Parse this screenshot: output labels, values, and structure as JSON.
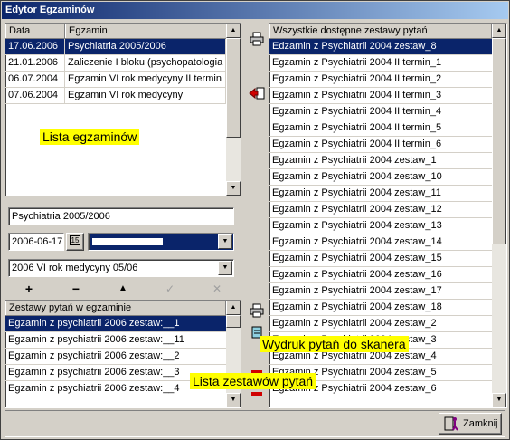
{
  "window": {
    "title": "Edytor Egzaminów"
  },
  "exams": {
    "columns": [
      "Data",
      "Egzamin"
    ],
    "rows": [
      {
        "date": "17.06.2006",
        "name": "Psychiatria 2005/2006",
        "selected": true
      },
      {
        "date": "21.01.2006",
        "name": "Zaliczenie I bloku (psychopatologia o",
        "selected": false
      },
      {
        "date": "06.07.2004",
        "name": "Egzamin VI rok medycyny II termin",
        "selected": false
      },
      {
        "date": "07.06.2004",
        "name": "Egzamin VI rok medycyny",
        "selected": false
      }
    ],
    "annotation": "Lista egzaminów"
  },
  "form": {
    "exam_name": "Psychiatria 2005/2006",
    "date": "2006-06-17",
    "date_button": "15",
    "group": "2006 VI rok medycyny 05/06"
  },
  "toolbar": {
    "add": "+",
    "remove": "−",
    "up": "▲",
    "confirm": "✓",
    "cancel": "✕"
  },
  "exam_sets": {
    "header": "Zestawy pytań w egzaminie",
    "rows": [
      {
        "label": "Egzamin z psychiatrii 2006 zestaw:__1",
        "selected": true
      },
      {
        "label": "Egzamin z psychiatrii 2006 zestaw:__11",
        "selected": false
      },
      {
        "label": "Egzamin z psychiatrii 2006 zestaw:__2",
        "selected": false
      },
      {
        "label": "Egzamin z psychiatrii 2006 zestaw:__3",
        "selected": false
      },
      {
        "label": "Egzamin z psychiatrii 2006 zestaw:__4",
        "selected": false
      }
    ]
  },
  "all_sets": {
    "header": "Wszystkie dostępne zestawy pytań",
    "rows": [
      {
        "label": "Edzamin z Psychiatrii 2004 zestaw_8",
        "selected": true
      },
      {
        "label": "Egzamin z Psychiatrii 2004 II termin_1",
        "selected": false
      },
      {
        "label": "Egzamin z Psychiatrii 2004 II termin_2",
        "selected": false
      },
      {
        "label": "Egzamin z Psychiatrii 2004 II termin_3",
        "selected": false
      },
      {
        "label": "Egzamin z Psychiatrii 2004 II termin_4",
        "selected": false
      },
      {
        "label": "Egzamin z Psychiatrii 2004 II termin_5",
        "selected": false
      },
      {
        "label": "Egzamin z Psychiatrii 2004 II termin_6",
        "selected": false
      },
      {
        "label": "Egzamin z Psychiatrii 2004 zestaw_1",
        "selected": false
      },
      {
        "label": "Egzamin z Psychiatrii 2004 zestaw_10",
        "selected": false
      },
      {
        "label": "Egzamin z Psychiatrii 2004 zestaw_11",
        "selected": false
      },
      {
        "label": "Egzamin z Psychiatrii 2004 zestaw_12",
        "selected": false
      },
      {
        "label": "Egzamin z Psychiatrii 2004 zestaw_13",
        "selected": false
      },
      {
        "label": "Egzamin z Psychiatrii 2004 zestaw_14",
        "selected": false
      },
      {
        "label": "Egzamin z Psychiatrii 2004 zestaw_15",
        "selected": false
      },
      {
        "label": "Egzamin z Psychiatrii 2004 zestaw_16",
        "selected": false
      },
      {
        "label": "Egzamin z Psychiatrii 2004 zestaw_17",
        "selected": false
      },
      {
        "label": "Egzamin z Psychiatrii 2004 zestaw_18",
        "selected": false
      },
      {
        "label": "Egzamin z Psychiatrii 2004 zestaw_2",
        "selected": false
      },
      {
        "label": "Egzamin z Psychiatrii 2004 zestaw_3",
        "selected": false
      },
      {
        "label": "Egzamin z Psychiatrii 2004 zestaw_4",
        "selected": false
      },
      {
        "label": "Egzamin z Psychiatrii 2004 zestaw_5",
        "selected": false
      },
      {
        "label": "Egzamin z Psychiatrii 2004 zestaw_6",
        "selected": false
      }
    ]
  },
  "annotations": {
    "print": "Wydruk pytań do skanera",
    "sets_list": "Lista zestawów pytań"
  },
  "footer": {
    "close_label": "Zamknij"
  },
  "colors": {
    "selection": "#0a246a",
    "annotation_bg": "#ffff00",
    "face": "#d4d0c8"
  }
}
